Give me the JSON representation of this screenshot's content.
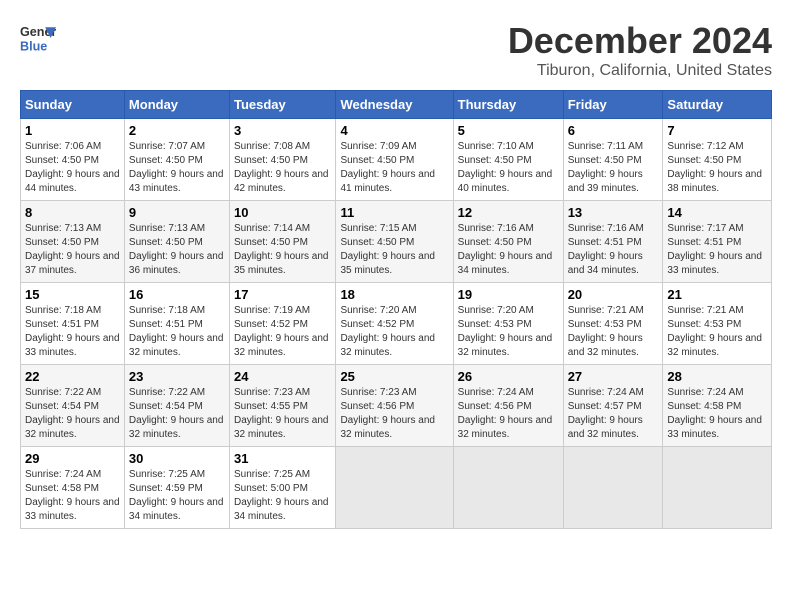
{
  "header": {
    "logo_line1": "General",
    "logo_line2": "Blue",
    "title": "December 2024",
    "subtitle": "Tiburon, California, United States"
  },
  "days_of_week": [
    "Sunday",
    "Monday",
    "Tuesday",
    "Wednesday",
    "Thursday",
    "Friday",
    "Saturday"
  ],
  "weeks": [
    [
      {
        "num": "1",
        "sunrise": "7:06 AM",
        "sunset": "4:50 PM",
        "daylight": "9 hours and 44 minutes."
      },
      {
        "num": "2",
        "sunrise": "7:07 AM",
        "sunset": "4:50 PM",
        "daylight": "9 hours and 43 minutes."
      },
      {
        "num": "3",
        "sunrise": "7:08 AM",
        "sunset": "4:50 PM",
        "daylight": "9 hours and 42 minutes."
      },
      {
        "num": "4",
        "sunrise": "7:09 AM",
        "sunset": "4:50 PM",
        "daylight": "9 hours and 41 minutes."
      },
      {
        "num": "5",
        "sunrise": "7:10 AM",
        "sunset": "4:50 PM",
        "daylight": "9 hours and 40 minutes."
      },
      {
        "num": "6",
        "sunrise": "7:11 AM",
        "sunset": "4:50 PM",
        "daylight": "9 hours and 39 minutes."
      },
      {
        "num": "7",
        "sunrise": "7:12 AM",
        "sunset": "4:50 PM",
        "daylight": "9 hours and 38 minutes."
      }
    ],
    [
      {
        "num": "8",
        "sunrise": "7:13 AM",
        "sunset": "4:50 PM",
        "daylight": "9 hours and 37 minutes."
      },
      {
        "num": "9",
        "sunrise": "7:13 AM",
        "sunset": "4:50 PM",
        "daylight": "9 hours and 36 minutes."
      },
      {
        "num": "10",
        "sunrise": "7:14 AM",
        "sunset": "4:50 PM",
        "daylight": "9 hours and 35 minutes."
      },
      {
        "num": "11",
        "sunrise": "7:15 AM",
        "sunset": "4:50 PM",
        "daylight": "9 hours and 35 minutes."
      },
      {
        "num": "12",
        "sunrise": "7:16 AM",
        "sunset": "4:50 PM",
        "daylight": "9 hours and 34 minutes."
      },
      {
        "num": "13",
        "sunrise": "7:16 AM",
        "sunset": "4:51 PM",
        "daylight": "9 hours and 34 minutes."
      },
      {
        "num": "14",
        "sunrise": "7:17 AM",
        "sunset": "4:51 PM",
        "daylight": "9 hours and 33 minutes."
      }
    ],
    [
      {
        "num": "15",
        "sunrise": "7:18 AM",
        "sunset": "4:51 PM",
        "daylight": "9 hours and 33 minutes."
      },
      {
        "num": "16",
        "sunrise": "7:18 AM",
        "sunset": "4:51 PM",
        "daylight": "9 hours and 32 minutes."
      },
      {
        "num": "17",
        "sunrise": "7:19 AM",
        "sunset": "4:52 PM",
        "daylight": "9 hours and 32 minutes."
      },
      {
        "num": "18",
        "sunrise": "7:20 AM",
        "sunset": "4:52 PM",
        "daylight": "9 hours and 32 minutes."
      },
      {
        "num": "19",
        "sunrise": "7:20 AM",
        "sunset": "4:53 PM",
        "daylight": "9 hours and 32 minutes."
      },
      {
        "num": "20",
        "sunrise": "7:21 AM",
        "sunset": "4:53 PM",
        "daylight": "9 hours and 32 minutes."
      },
      {
        "num": "21",
        "sunrise": "7:21 AM",
        "sunset": "4:53 PM",
        "daylight": "9 hours and 32 minutes."
      }
    ],
    [
      {
        "num": "22",
        "sunrise": "7:22 AM",
        "sunset": "4:54 PM",
        "daylight": "9 hours and 32 minutes."
      },
      {
        "num": "23",
        "sunrise": "7:22 AM",
        "sunset": "4:54 PM",
        "daylight": "9 hours and 32 minutes."
      },
      {
        "num": "24",
        "sunrise": "7:23 AM",
        "sunset": "4:55 PM",
        "daylight": "9 hours and 32 minutes."
      },
      {
        "num": "25",
        "sunrise": "7:23 AM",
        "sunset": "4:56 PM",
        "daylight": "9 hours and 32 minutes."
      },
      {
        "num": "26",
        "sunrise": "7:24 AM",
        "sunset": "4:56 PM",
        "daylight": "9 hours and 32 minutes."
      },
      {
        "num": "27",
        "sunrise": "7:24 AM",
        "sunset": "4:57 PM",
        "daylight": "9 hours and 32 minutes."
      },
      {
        "num": "28",
        "sunrise": "7:24 AM",
        "sunset": "4:58 PM",
        "daylight": "9 hours and 33 minutes."
      }
    ],
    [
      {
        "num": "29",
        "sunrise": "7:24 AM",
        "sunset": "4:58 PM",
        "daylight": "9 hours and 33 minutes."
      },
      {
        "num": "30",
        "sunrise": "7:25 AM",
        "sunset": "4:59 PM",
        "daylight": "9 hours and 34 minutes."
      },
      {
        "num": "31",
        "sunrise": "7:25 AM",
        "sunset": "5:00 PM",
        "daylight": "9 hours and 34 minutes."
      },
      null,
      null,
      null,
      null
    ]
  ],
  "labels": {
    "sunrise": "Sunrise:",
    "sunset": "Sunset:",
    "daylight": "Daylight:"
  }
}
